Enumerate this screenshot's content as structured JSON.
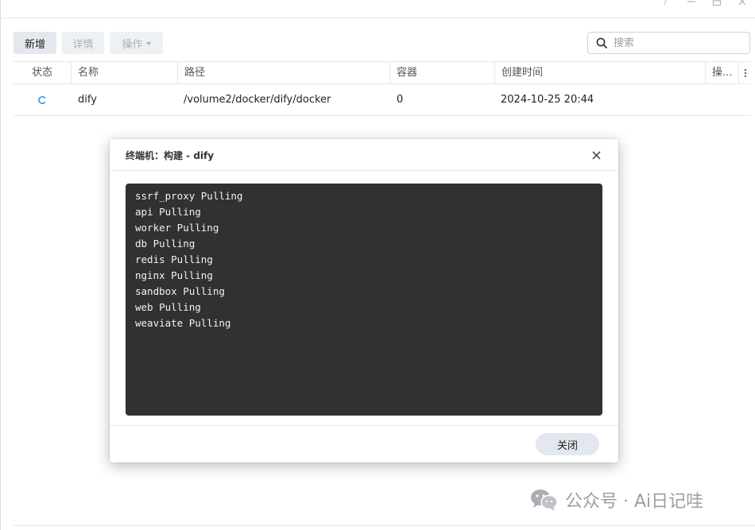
{
  "window": {
    "controls": [
      "help-icon",
      "minimize-icon",
      "restore-icon",
      "close-icon"
    ]
  },
  "toolbar": {
    "new_label": "新增",
    "detail_label": "详情",
    "action_label": "操作"
  },
  "search": {
    "placeholder": "搜索",
    "value": ""
  },
  "table": {
    "headers": {
      "status": "状态",
      "name": "名称",
      "path": "路径",
      "containers": "容器",
      "created": "创建时间",
      "actions": "操..."
    },
    "rows": [
      {
        "status_icon": "loading-spinner-icon",
        "name": "dify",
        "path": "/volume2/docker/dify/docker",
        "containers": "0",
        "created": "2024-10-25 20:44"
      }
    ]
  },
  "dialog": {
    "title": "终端机：构建 - dify",
    "terminal_lines": [
      "ssrf_proxy Pulling",
      "api Pulling",
      "worker Pulling",
      "db Pulling",
      "redis Pulling",
      "nginx Pulling",
      "sandbox Pulling",
      "web Pulling",
      "weaviate Pulling"
    ],
    "close_label": "关闭"
  },
  "watermark": {
    "text": "公众号 · Ai日记哇",
    "icon": "wechat-logo-icon"
  },
  "colors": {
    "accent": "#1a8fe3",
    "terminal_bg": "#313131",
    "button_bg": "#e3e8ee"
  }
}
